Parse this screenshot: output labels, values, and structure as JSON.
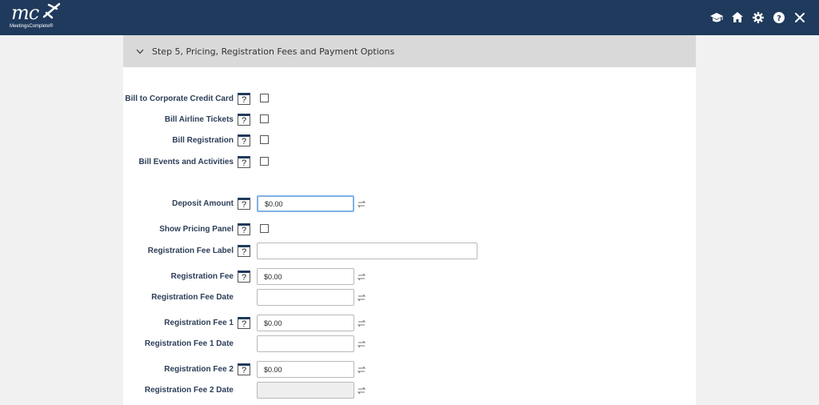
{
  "header": {
    "logo_text": "mc",
    "logo_subtext": "MeetingsComplete®",
    "icons": [
      "graduation-cap-icon",
      "home-icon",
      "gear-icon",
      "help-icon",
      "close-icon"
    ]
  },
  "step": {
    "title": "Step 5, Pricing, Registration Fees and Payment Options"
  },
  "form": {
    "bill_corporate_card": {
      "label": "Bill to Corporate Credit Card",
      "help": "?"
    },
    "bill_airline": {
      "label": "Bill Airline Tickets",
      "help": "?"
    },
    "bill_registration": {
      "label": "Bill Registration",
      "help": "?"
    },
    "bill_events": {
      "label": "Bill Events and Activities",
      "help": "?"
    },
    "deposit_amount": {
      "label": "Deposit Amount",
      "help": "?",
      "value": "$0.00"
    },
    "show_pricing_panel": {
      "label": "Show Pricing Panel",
      "help": "?"
    },
    "reg_fee_label": {
      "label": "Registration Fee Label",
      "help": "?",
      "value": ""
    },
    "reg_fee": {
      "label": "Registration Fee",
      "help": "?",
      "value": "$0.00"
    },
    "reg_fee_date": {
      "label": "Registration Fee Date",
      "value": ""
    },
    "reg_fee_1": {
      "label": "Registration Fee 1",
      "help": "?",
      "value": "$0.00"
    },
    "reg_fee_1_date": {
      "label": "Registration Fee 1 Date",
      "value": ""
    },
    "reg_fee_2": {
      "label": "Registration Fee 2",
      "help": "?",
      "value": "$0.00"
    },
    "reg_fee_2_date": {
      "label": "Registration Fee 2 Date",
      "value": ""
    }
  },
  "colors": {
    "header_bg": "#1f3a5c",
    "label": "#2c3e58",
    "focus": "#7fb2e5"
  }
}
